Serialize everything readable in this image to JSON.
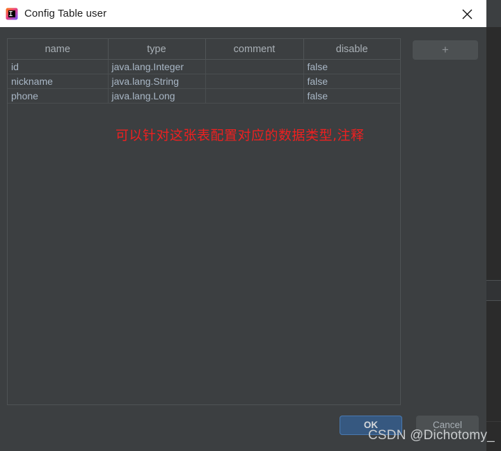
{
  "window": {
    "title": "Config Table user",
    "icon": "intellij-idea-icon",
    "close_label": "×"
  },
  "table": {
    "columns": [
      "name",
      "type",
      "comment",
      "disable"
    ],
    "rows": [
      {
        "name": "id",
        "type": "java.lang.Integer",
        "comment": "",
        "disable": "false"
      },
      {
        "name": "nickname",
        "type": "java.lang.String",
        "comment": "",
        "disable": "false"
      },
      {
        "name": "phone",
        "type": "java.lang.Long",
        "comment": "",
        "disable": "false"
      }
    ]
  },
  "annotation": {
    "text": "可以针对这张表配置对应的数据类型,注释",
    "color": "#ee2020"
  },
  "toolbar": {
    "add_label": "+"
  },
  "footer": {
    "ok_label": "OK",
    "cancel_label": "Cancel"
  },
  "watermark": {
    "text": "CSDN @Dichotomy_"
  },
  "theme": {
    "dialog_background": "#3c3f41",
    "titlebar_background": "#ffffff",
    "accent": "#365880",
    "text": "#a9b7c6",
    "editor_background": "#2b2b2b"
  }
}
